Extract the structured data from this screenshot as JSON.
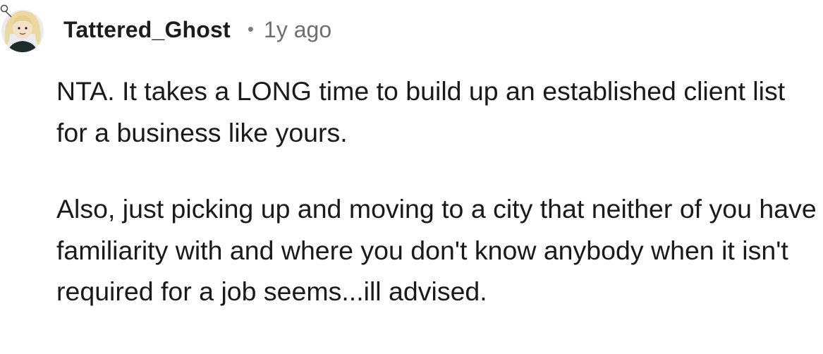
{
  "comment": {
    "author": "Tattered_Ghost",
    "separator": "•",
    "timestamp": "1y ago",
    "avatar_icon": "snoo-avatar-icon",
    "paragraphs": [
      "NTA. It takes a LONG time to build up an established client list for a business like yours.",
      "Also, just picking up and moving to a city that neither of you have familiarity with and where you don't know anybody when it isn't required for a job seems...ill advised."
    ]
  },
  "colors": {
    "background": "#ffffff",
    "text": "#1a1a1b",
    "meta": "#6f6f6f",
    "avatar_bg": "#e9ecef"
  }
}
